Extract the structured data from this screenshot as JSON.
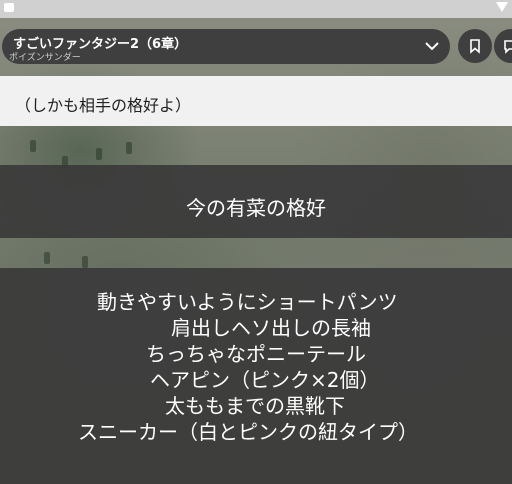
{
  "header": {
    "title": "すごいファンタジー2（6章）",
    "subtitle": "ポイズンサンダー"
  },
  "speech_box": {
    "text": "（しかも相手の格好よ）"
  },
  "narration": {
    "heading": "今の有菜の格好",
    "lines": [
      "動きやすいようにショートパンツ",
      "肩出しヘソ出しの長袖",
      "ちっちゃなポニーテール",
      "ヘアピン（ピンク×2個）",
      "太ももまでの黒靴下",
      "スニーカー（白とピンクの紐タイプ）"
    ]
  },
  "icons": {
    "expand": "chevron-down-icon",
    "bookmark": "bookmark-icon",
    "comment": "comment-icon",
    "camera": "camera-icon",
    "signal": "signal-icon"
  }
}
